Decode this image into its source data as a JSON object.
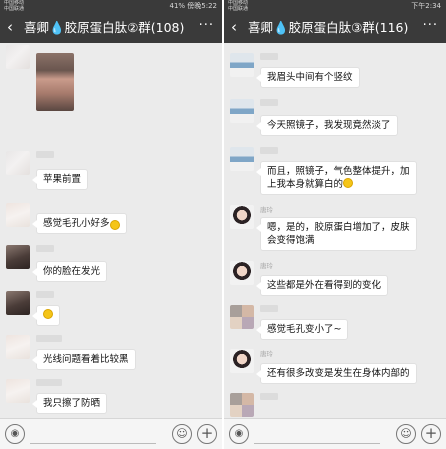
{
  "left": {
    "status": {
      "carrier": "中国移动\n中国联通",
      "right": "41% 傍晚5:22"
    },
    "header": {
      "back_icon": "‹",
      "title": "喜卿💧胶原蛋白肽②群(108)",
      "more_icon": "···"
    },
    "messages": [
      {
        "type": "photo"
      },
      {
        "type": "text",
        "text": "苹果前置"
      },
      {
        "type": "text",
        "text": "感觉毛孔小好多",
        "emoji": "😂"
      },
      {
        "type": "text",
        "text": "你的脸在发光"
      },
      {
        "type": "emoji"
      },
      {
        "type": "text",
        "text": "光线问题看着比较黑"
      },
      {
        "type": "text",
        "text": "我只擦了防晒"
      }
    ],
    "input": {
      "voice_icon": "◉",
      "face_icon": "☺",
      "plus_icon": "+"
    }
  },
  "right": {
    "status": {
      "carrier": "中国移动\n中国联通",
      "right": "下午2:34"
    },
    "header": {
      "back_icon": "‹",
      "title": "喜卿💧胶原蛋白肽③群(116)",
      "more_icon": "···"
    },
    "messages": [
      {
        "type": "text",
        "text": "我眉头中间有个竖纹"
      },
      {
        "type": "text",
        "text": "今天照镜子，我发现竟然淡了"
      },
      {
        "type": "text",
        "line1": "而且，照镜子，气色整体提升，加",
        "line2": "上我本身就算白的"
      },
      {
        "type": "text",
        "name": "唐玲",
        "line1": "嗯，是的，胶原蛋白增加了，皮肤",
        "line2": "会变得饱满"
      },
      {
        "type": "text",
        "name": "唐玲",
        "text": "这些都是外在看得到的变化"
      },
      {
        "type": "text",
        "text": "感觉毛孔变小了~"
      },
      {
        "type": "text",
        "name": "唐玲",
        "text": "还有很多改变是发生在身体内部的"
      }
    ],
    "input": {
      "voice_icon": "◉",
      "face_icon": "☺",
      "plus_icon": "+"
    }
  }
}
